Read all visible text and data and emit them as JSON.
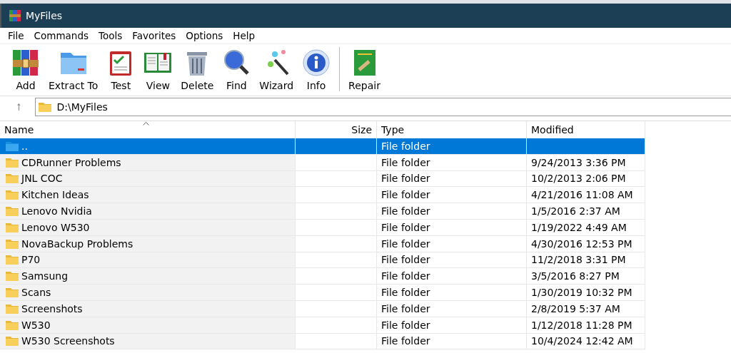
{
  "window": {
    "title": "MyFiles"
  },
  "menu": [
    "File",
    "Commands",
    "Tools",
    "Favorites",
    "Options",
    "Help"
  ],
  "toolbar": [
    {
      "label": "Add",
      "kind": "archive"
    },
    {
      "label": "Extract To",
      "kind": "folder"
    },
    {
      "label": "Test",
      "kind": "clipboard"
    },
    {
      "label": "View",
      "kind": "book"
    },
    {
      "label": "Delete",
      "kind": "trash"
    },
    {
      "label": "Find",
      "kind": "magnifier"
    },
    {
      "label": "Wizard",
      "kind": "wand"
    },
    {
      "label": "Info",
      "kind": "info"
    },
    {
      "label": "Repair",
      "kind": "repair",
      "separated": true
    }
  ],
  "address": {
    "up": "↑",
    "path": "D:\\MyFiles"
  },
  "table": {
    "columns": [
      {
        "label": "Name",
        "sorted": true
      },
      {
        "label": "Size",
        "sorted": false
      },
      {
        "label": "Type",
        "sorted": false
      },
      {
        "label": "Modified",
        "sorted": false
      }
    ],
    "rows": [
      {
        "name": "..",
        "kind": "parent",
        "size": "",
        "type": "File folder",
        "modified": "",
        "selected": true
      },
      {
        "name": "CDRunner Problems",
        "kind": "folder",
        "type": "File folder",
        "modified": "9/24/2013 3:36 PM",
        "selected": false
      },
      {
        "name": "JNL COC",
        "kind": "folder",
        "type": "File folder",
        "modified": "10/2/2013 2:06 PM",
        "selected": false
      },
      {
        "name": "Kitchen Ideas",
        "kind": "folder",
        "type": "File folder",
        "modified": "4/21/2016 11:08 AM",
        "selected": false
      },
      {
        "name": "Lenovo Nvidia",
        "kind": "folder",
        "type": "File folder",
        "modified": "1/5/2016 2:37 AM",
        "selected": false
      },
      {
        "name": "Lenovo W530",
        "kind": "folder",
        "type": "File folder",
        "modified": "1/19/2022 4:49 AM",
        "selected": false
      },
      {
        "name": "NovaBackup Problems",
        "kind": "folder",
        "type": "File folder",
        "modified": "4/30/2016 12:53 PM",
        "selected": false
      },
      {
        "name": "P70",
        "kind": "folder",
        "type": "File folder",
        "modified": "11/2/2018 3:31 PM",
        "selected": false
      },
      {
        "name": "Samsung",
        "kind": "folder",
        "type": "File folder",
        "modified": "3/5/2016 8:27 PM",
        "selected": false
      },
      {
        "name": "Scans",
        "kind": "folder",
        "type": "File folder",
        "modified": "1/30/2019 10:32 PM",
        "selected": false
      },
      {
        "name": "Screenshots",
        "kind": "folder",
        "type": "File folder",
        "modified": "2/8/2019 5:37 AM",
        "selected": false
      },
      {
        "name": "W530",
        "kind": "folder",
        "type": "File folder",
        "modified": "1/12/2018 11:28 PM",
        "selected": false
      },
      {
        "name": "W530 Screenshots",
        "kind": "folder",
        "type": "File folder",
        "modified": "10/4/2024 12:42 AM",
        "selected": false
      }
    ]
  }
}
